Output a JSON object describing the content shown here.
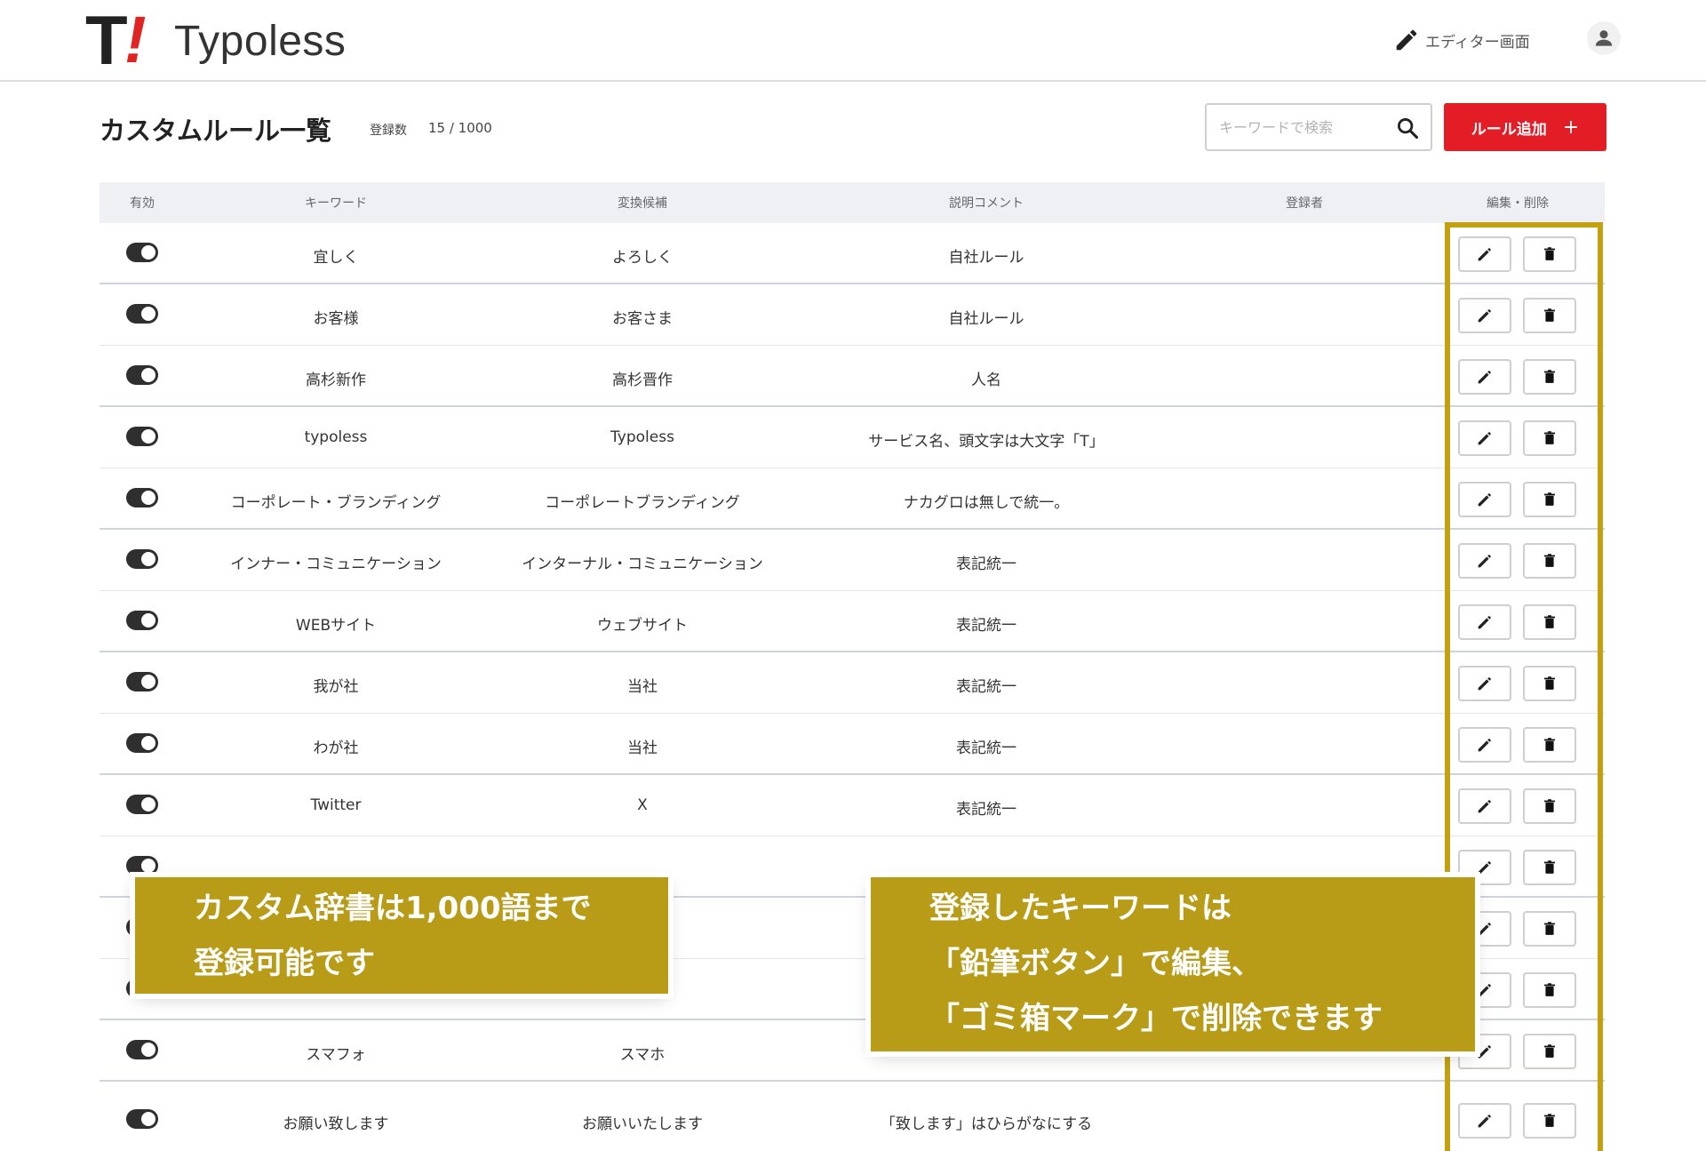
{
  "header": {
    "logo_mark": "T",
    "logo_text": "Typoless",
    "editor_link": "エディター画面"
  },
  "main": {
    "title": "カスタムルール一覧",
    "count_label": "登録数",
    "count_value": "15 / 1000",
    "search_placeholder": "キーワードで検索",
    "add_button": "ルール追加"
  },
  "table": {
    "columns": [
      "有効",
      "キーワード",
      "変換候補",
      "説明コメント",
      "登録者",
      "編集・削除"
    ],
    "rows": [
      {
        "enabled": true,
        "keyword": "宜しく",
        "candidate": "よろしく",
        "comment": "自社ルール",
        "registrant": ""
      },
      {
        "enabled": true,
        "keyword": "お客様",
        "candidate": "お客さま",
        "comment": "自社ルール",
        "registrant": ""
      },
      {
        "enabled": true,
        "keyword": "高杉新作",
        "candidate": "高杉晋作",
        "comment": "人名",
        "registrant": ""
      },
      {
        "enabled": true,
        "keyword": "typoless",
        "candidate": "Typoless",
        "comment": "サービス名、頭文字は大文字「T」",
        "registrant": ""
      },
      {
        "enabled": true,
        "keyword": "コーポレート・ブランディング",
        "candidate": "コーポレートブランディング",
        "comment": "ナカグロは無しで統一。",
        "registrant": ""
      },
      {
        "enabled": true,
        "keyword": "インナー・コミュニケーション",
        "candidate": "インターナル・コミュニケーション",
        "comment": "表記統一",
        "registrant": ""
      },
      {
        "enabled": true,
        "keyword": "WEBサイト",
        "candidate": "ウェブサイト",
        "comment": "表記統一",
        "registrant": ""
      },
      {
        "enabled": true,
        "keyword": "我が社",
        "candidate": "当社",
        "comment": "表記統一",
        "registrant": ""
      },
      {
        "enabled": true,
        "keyword": "わが社",
        "candidate": "当社",
        "comment": "表記統一",
        "registrant": ""
      },
      {
        "enabled": true,
        "keyword": "Twitter",
        "candidate": "X",
        "comment": "表記統一",
        "registrant": ""
      },
      {
        "enabled": true,
        "keyword": "",
        "candidate": "",
        "comment": "",
        "registrant": ""
      },
      {
        "enabled": true,
        "keyword": "",
        "candidate": "",
        "comment": "",
        "registrant": ""
      },
      {
        "enabled": true,
        "keyword": "",
        "candidate": "",
        "comment": "",
        "registrant": ""
      },
      {
        "enabled": true,
        "keyword": "スマフォ",
        "candidate": "スマホ",
        "comment": "",
        "registrant": ""
      },
      {
        "enabled": true,
        "keyword": "お願い致します",
        "candidate": "お願いいたします",
        "comment": "「致します」はひらがなにする",
        "registrant": ""
      }
    ]
  },
  "callouts": {
    "left": [
      "カスタム辞書は1,000語まで",
      "登録可能です"
    ],
    "right": [
      "登録したキーワードは",
      "「鉛筆ボタン」で編集、",
      "「ゴミ箱マーク」で削除できます"
    ]
  },
  "colors": {
    "accent_red": "#e31d25",
    "callout_gold": "#b89b16",
    "highlight_frame": "#c2a111"
  }
}
